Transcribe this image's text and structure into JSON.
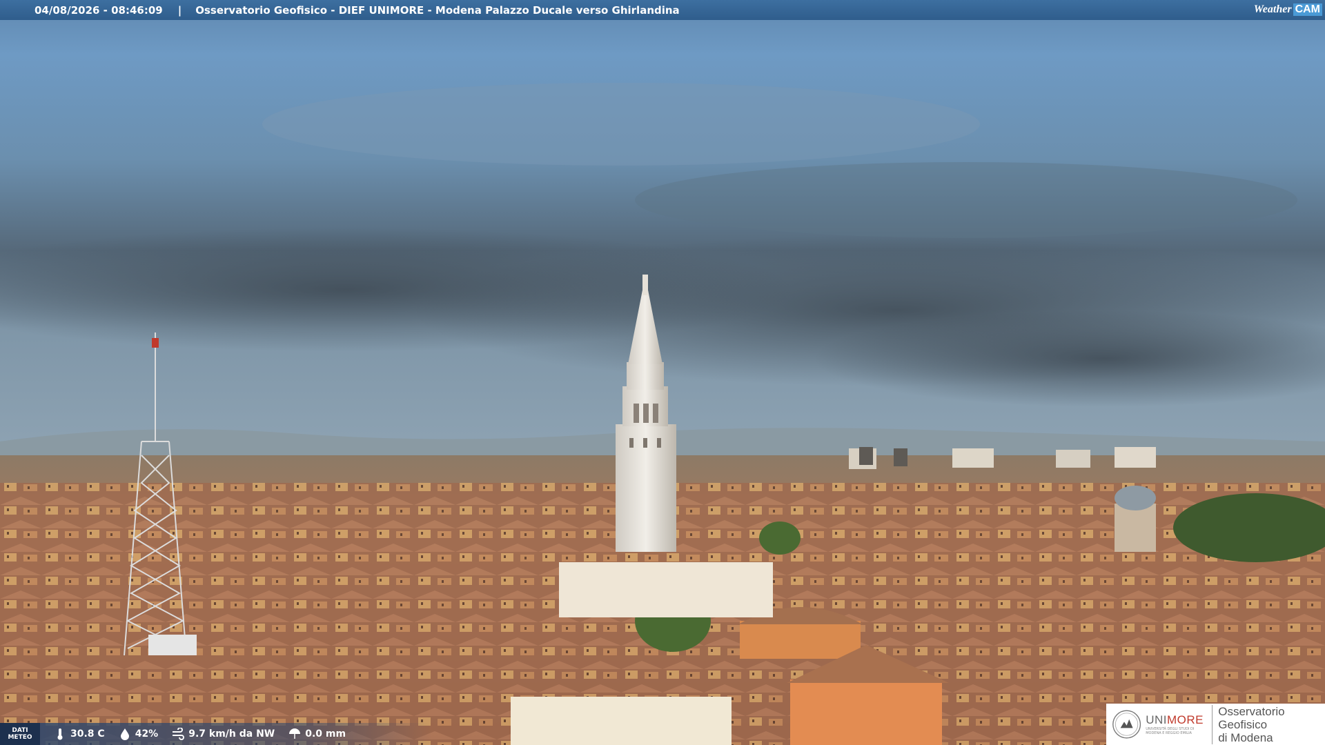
{
  "overlay": {
    "timestamp": "04/08/2026 - 08:46:09",
    "separator": "|",
    "caption": "Osservatorio Geofisico - DIEF UNIMORE - Modena Palazzo Ducale verso Ghirlandina",
    "brand_weather": "Weather",
    "brand_cam": "CAM"
  },
  "weather": {
    "label_line1": "DATI",
    "label_line2": "METEO",
    "temperature": "30.8 C",
    "humidity": "42%",
    "wind": "9.7 km/h da NW",
    "rain": "0.0 mm"
  },
  "logo": {
    "uni_name_prefix": "UNI",
    "uni_name_accent": "MORE",
    "uni_sub_line1": "UNIVERSITÀ DEGLI STUDI DI",
    "uni_sub_line2": "MODENA E REGGIO EMILIA",
    "obs_line1": "Osservatorio Geofisico",
    "obs_line2": "di Modena"
  },
  "colors": {
    "topbar": "#3d6fa0",
    "sky_top": "#6f9cc8",
    "smoke": "#4b5a66",
    "roofs": "#a8705a"
  }
}
